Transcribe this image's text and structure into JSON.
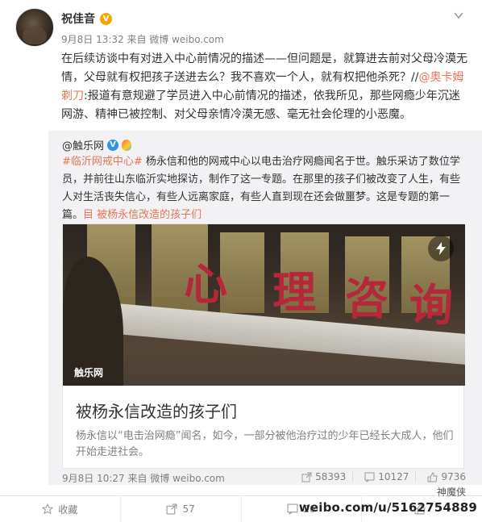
{
  "post": {
    "author": "祝佳音",
    "meta": "9月8日 13:32 来自 微博 weibo.com",
    "text_parts": {
      "p1": "在后续访谈中有对进入中心前情况的描述——但问题是，就算进去前对父母冷漠无情，父母就有权把孩子送进去么？我不喜欢一个人，就有权把他杀死？//",
      "mention": "@奥卡姆剃刀",
      "p2": ":报道有意规避了学员进入中心前情况的描述，依我所见，那些网瘾少年沉迷网游、精神已被控制、对父母亲情冷漠无感、毫无社会伦理的小恶魔。"
    }
  },
  "repost": {
    "author": "@触乐网",
    "tag": "#临沂网戒中心#",
    "text": " 杨永信和他的网戒中心以电击治疗网瘾闻名于世。触乐采访了数位学员，并前往山东临沂实地探访，制作了这一专题。在那里的孩子们被改变了人生，有些人对生活丧失信心，有些人远离家庭，有些人直到现在还会做噩梦。这是专题的第一篇。",
    "link": "目 被杨永信改造的孩子们",
    "card": {
      "image_sign": [
        "心",
        "理",
        "咨",
        "询"
      ],
      "brand": "触乐网",
      "title": "被杨永信改造的孩子们",
      "desc": "杨永信以“电击治网瘾”闻名，如今，一部分被他治疗过的少年已经长大成人，他们开始走进社会。"
    },
    "time": "9月8日 10:27 来自 微博 weibo.com",
    "stats": {
      "reposts": "58393",
      "comments": "10127",
      "likes": "9736"
    }
  },
  "toolbar": {
    "favorite": "收藏",
    "repost": "57",
    "comment": "26",
    "like": ""
  },
  "watermark": {
    "top": "神魔侠",
    "url": "weibo.com/u/5162754889"
  },
  "colors": {
    "link": "#eb7350",
    "muted": "#808080",
    "repost_bg": "#f2f2f5"
  }
}
